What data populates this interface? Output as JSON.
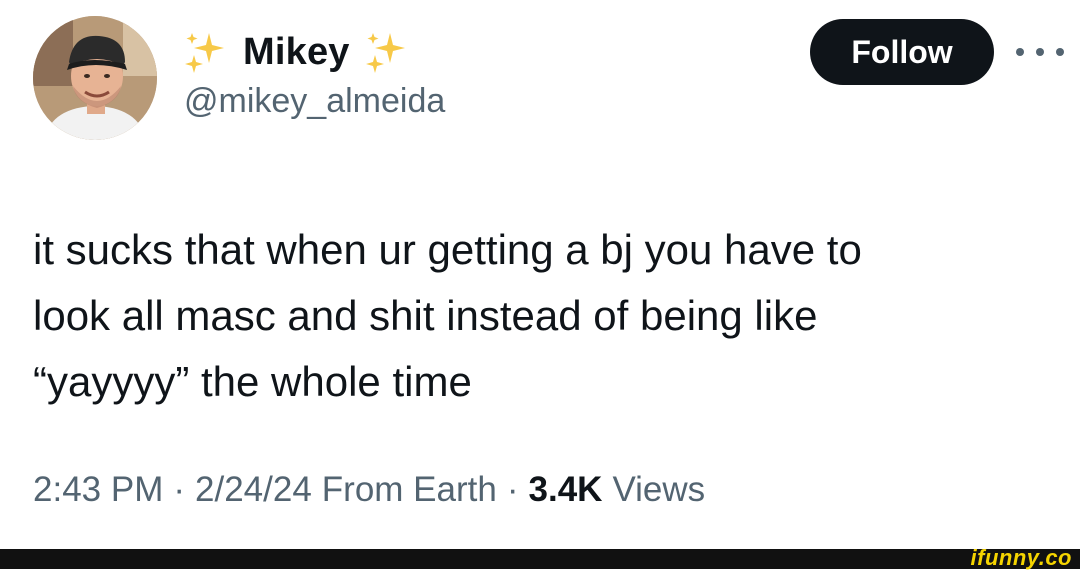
{
  "author": {
    "display_name": "Mikey",
    "handle": "@mikey_almeida",
    "sparkle_icon": "sparkles-emoji",
    "avatar_icon": "profile-photo"
  },
  "follow_button": {
    "label": "Follow"
  },
  "more_menu": {
    "icon": "more-horizontal-icon"
  },
  "tweet": {
    "lines": [
      "it sucks that when ur getting a bj you have to",
      "look all masc and shit instead of being like",
      "“yayyyy” the whole time"
    ]
  },
  "meta": {
    "time": "2:43 PM",
    "separator": "·",
    "date": "2/24/24",
    "source": "From Earth",
    "views_count": "3.4K",
    "views_label": "Views"
  },
  "watermark": {
    "text": "ifunny.co"
  },
  "colors": {
    "text_primary": "#0f1419",
    "text_secondary": "#536471",
    "button_bg": "#0f1419",
    "sparkle": "#f7c948",
    "watermark": "#f5d400"
  }
}
